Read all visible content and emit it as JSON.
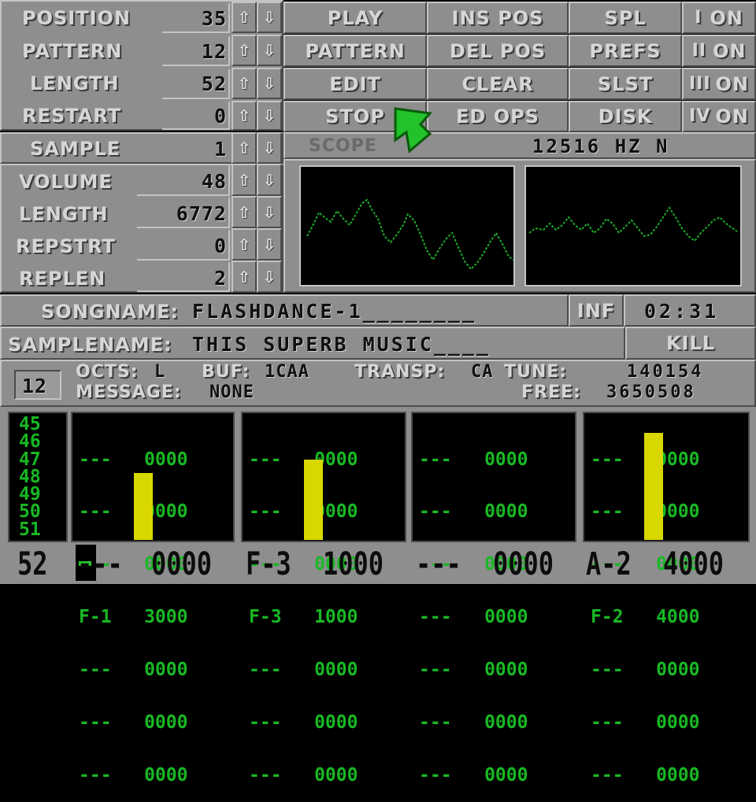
{
  "controls": {
    "rows": [
      {
        "label": "POSITION",
        "value": "35"
      },
      {
        "label": "PATTERN",
        "value": "12"
      },
      {
        "label": "LENGTH",
        "value": "52"
      },
      {
        "label": "RESTART",
        "value": "0"
      }
    ],
    "up_arrow": "⇧",
    "down_arrow": "⇩",
    "buttons_col1": [
      "PLAY",
      "PATTERN",
      "EDIT",
      "STOP"
    ],
    "buttons_col2": [
      "INS POS",
      "DEL POS",
      "CLEAR",
      "ED OPS"
    ],
    "buttons_col3": [
      "SPL",
      "PREFS",
      "SLST",
      "DISK"
    ],
    "channels": [
      {
        "num": "I",
        "label": "ON"
      },
      {
        "num": "II",
        "label": "ON"
      },
      {
        "num": "III",
        "label": "ON"
      },
      {
        "num": "IV",
        "label": "ON"
      }
    ]
  },
  "sample": {
    "label": "SAMPLE",
    "value": "1",
    "rows": [
      {
        "label": "VOLUME",
        "value": "48"
      },
      {
        "label": "LENGTH",
        "value": "6772"
      },
      {
        "label": "REPSTRT",
        "value": "0"
      },
      {
        "label": "REPLEN",
        "value": "2"
      }
    ]
  },
  "scope": {
    "label": "SCOPE",
    "freq": "12516 HZ N"
  },
  "song": {
    "label": "SONGNAME:",
    "name": "FLASHDANCE-1________",
    "inf": "INF",
    "time": "02:31"
  },
  "samplename": {
    "label": "SAMPLENAME:",
    "name": "THIS SUPERB MUSIC____",
    "kill": "KILL"
  },
  "status": {
    "pattern_num": "12",
    "octs_label": "OCTS:",
    "octs": "L",
    "buf_label": "BUF:",
    "buf": "1CAA",
    "transp_label": "TRANSP:",
    "transp": "CA",
    "tune_label": "TUNE:",
    "tune": "140154",
    "message_label": "MESSAGE:",
    "message": "NONE",
    "free_label": "FREE:",
    "free": "3650508"
  },
  "pattern": {
    "lines": [
      "45",
      "46",
      "47",
      "48",
      "49",
      "50",
      "51"
    ],
    "tracks": [
      {
        "rows": [
          "---   0000",
          "---   0000",
          "---   0000",
          "F-1   3000",
          "---   0000",
          "---   0000",
          "---   0000"
        ],
        "level": 0.5
      },
      {
        "rows": [
          "---   0000",
          "---   0000",
          "---   0000",
          "F-3   1000",
          "---   0000",
          "---   0000",
          "---   0000"
        ],
        "level": 0.6
      },
      {
        "rows": [
          "---   0000",
          "---   0000",
          "---   0000",
          "---   0000",
          "---   0000",
          "---   0000",
          "---   0000"
        ],
        "level": 0
      },
      {
        "rows": [
          "---   0000",
          "---   0000",
          "---   0000",
          "F-2   4000",
          "---   0000",
          "---   0000",
          "---   0000"
        ],
        "level": 0.8
      }
    ],
    "current_line": "52",
    "current": [
      {
        "note": "---",
        "value": "0000"
      },
      {
        "note": "F-3",
        "value": "1000"
      },
      {
        "note": "---",
        "value": "0000"
      },
      {
        "note": "A-2",
        "value": "4000"
      }
    ]
  },
  "colors": {
    "panel": "#8e8e8e",
    "pattern_green": "#18b824",
    "vu_yellow": "#d8d800",
    "pointer": "#22c22a"
  },
  "icons": [
    "up-arrow-icon",
    "down-arrow-icon",
    "mouse-pointer-icon"
  ]
}
